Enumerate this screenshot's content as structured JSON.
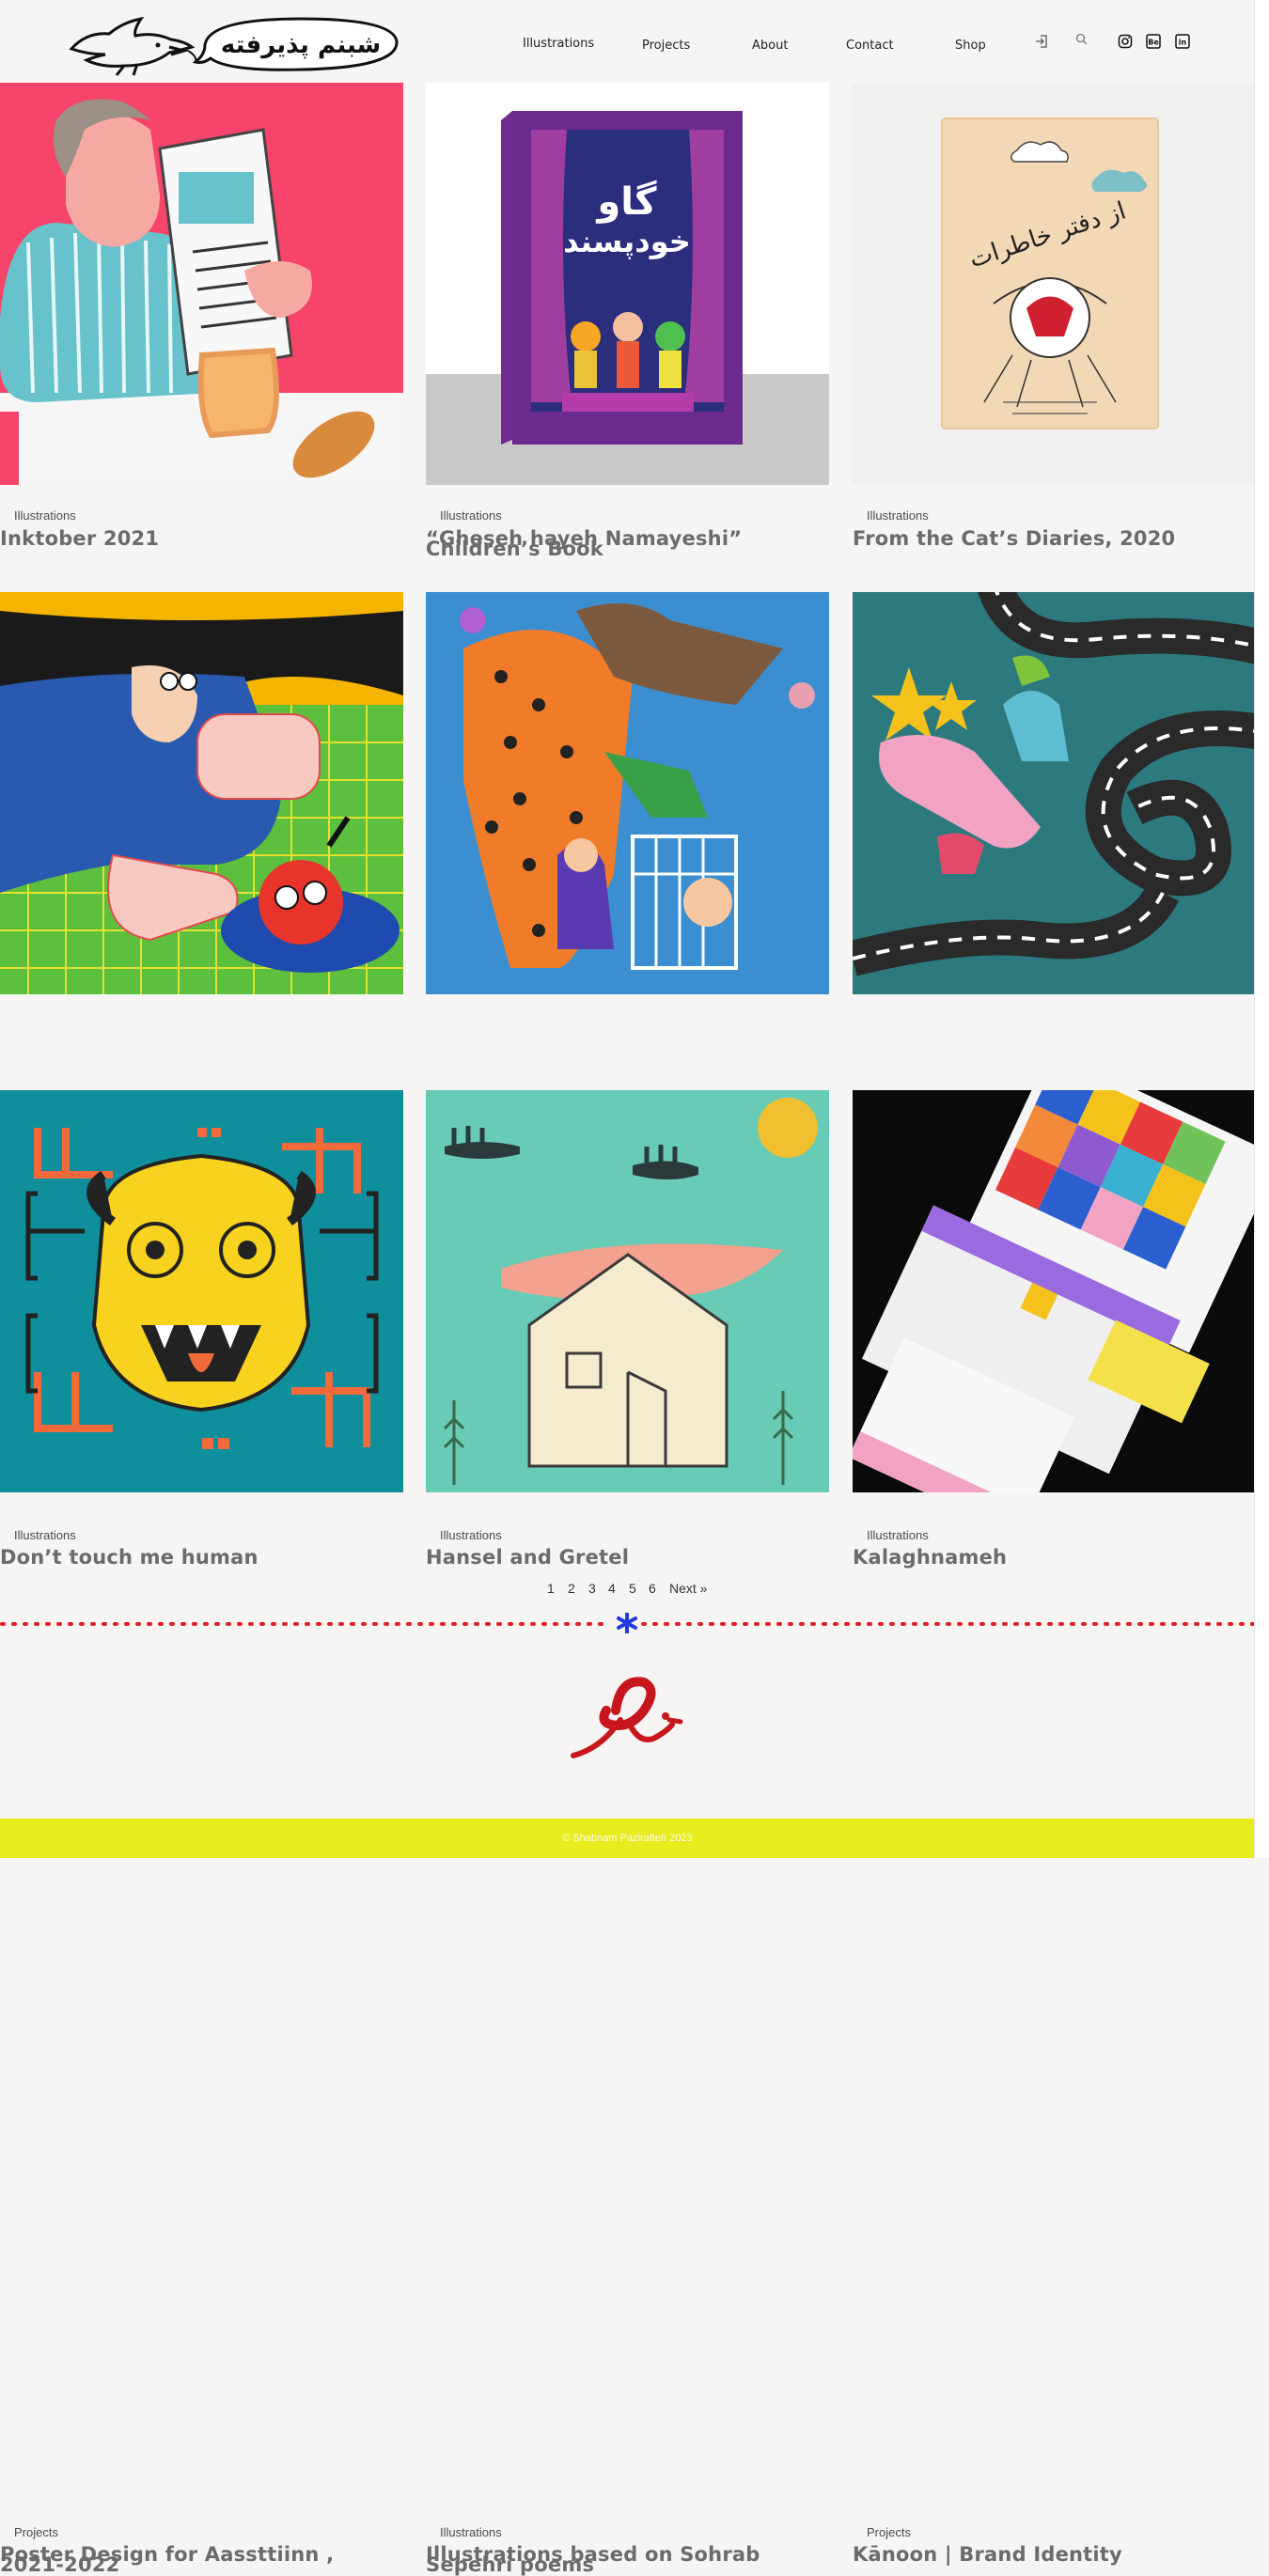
{
  "header": {
    "logo_text": "شبنم پذیرفته",
    "nav": [
      "Illustrations",
      "Projects",
      "About",
      "Contact",
      "Shop"
    ],
    "icons": [
      "login-icon",
      "search-icon",
      "instagram-icon",
      "behance-icon",
      "linkedin-icon"
    ]
  },
  "cards": [
    {
      "category": "Illustrations",
      "title": "Inktober 2021"
    },
    {
      "category": "Illustrations",
      "title": "“Gheseh hayeh Namayeshi” Children’s Book"
    },
    {
      "category": "Illustrations",
      "title": "From the Cat’s Diaries, 2020"
    },
    {
      "category": "Illustrations",
      "title": "Don’t touch me human"
    },
    {
      "category": "Illustrations",
      "title": "Hansel and Gretel"
    },
    {
      "category": "Illustrations",
      "title": "Kalaghnameh"
    },
    {
      "category": "Projects",
      "title": "Poster Design for Aassttiinn , 2021-2022"
    },
    {
      "category": "Illustrations",
      "title": "Illustrations based on Sohrab Sepehri poems"
    },
    {
      "category": "Projects",
      "title": "Kānoon | Brand Identity"
    }
  ],
  "pagination": {
    "pages": [
      "1",
      "2",
      "3",
      "4",
      "5",
      "6"
    ],
    "next": "Next »"
  },
  "footer": {
    "copyright": "© Shabnam Pazirafteh 2023"
  },
  "colors": {
    "accent_red": "#e02020",
    "footer_yellow": "#e7ec1e",
    "asterisk_blue": "#1f3bdc",
    "background": "#f7f5f3"
  }
}
